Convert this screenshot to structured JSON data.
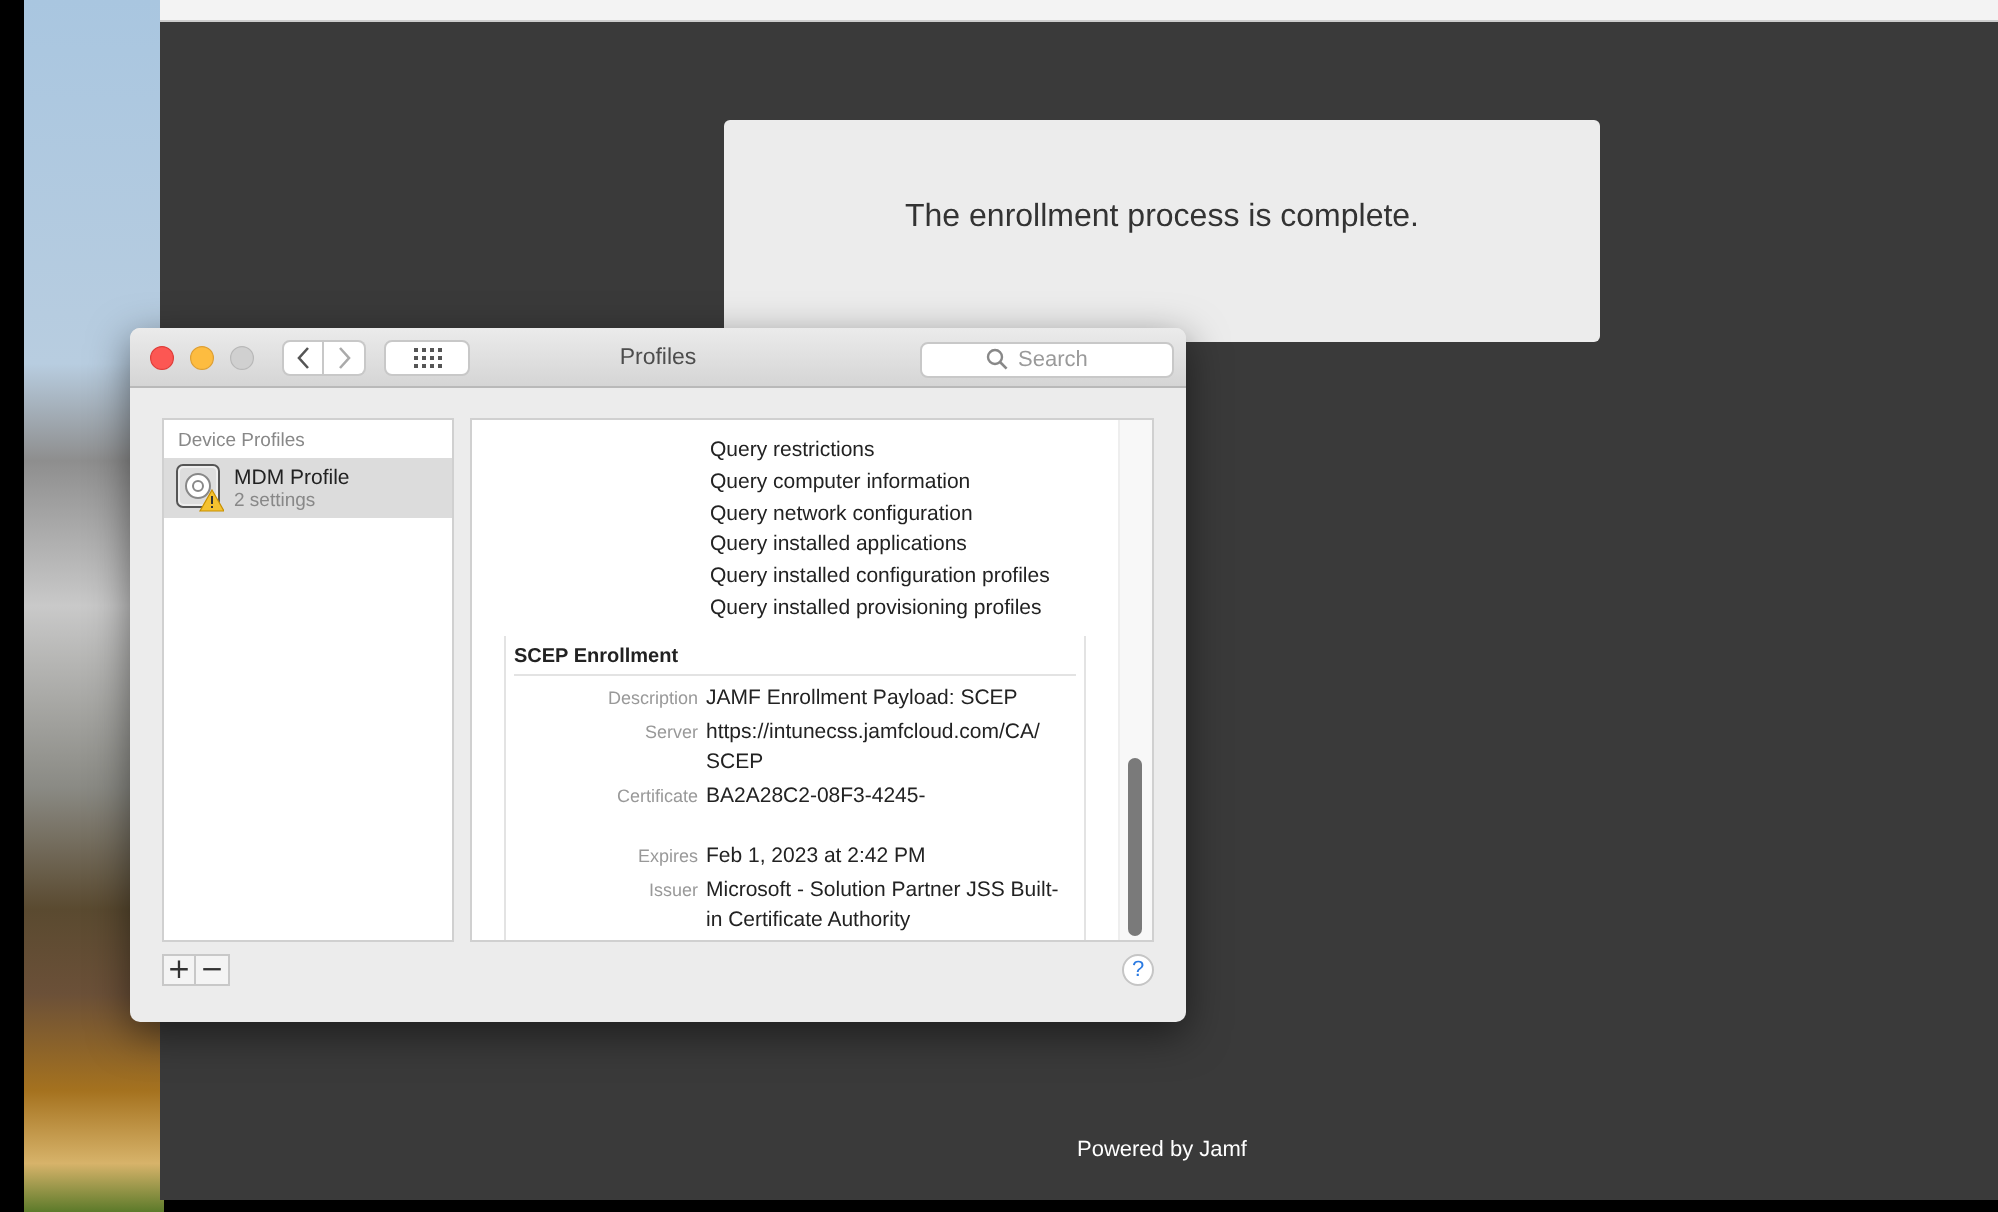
{
  "browser": {
    "message": "The enrollment process is complete.",
    "footer": "Powered by Jamf"
  },
  "window": {
    "title": "Profiles",
    "search": {
      "placeholder": "Search"
    }
  },
  "sidebar": {
    "heading": "Device Profiles",
    "items": [
      {
        "name": "MDM Profile",
        "detail": "2 settings",
        "selected": true
      }
    ]
  },
  "detail": {
    "permissions": [
      "Query restrictions",
      "Query computer information",
      "Query network configuration",
      "Query installed applications",
      "Query installed configuration profiles",
      "Query installed provisioning profiles"
    ],
    "sections": [
      {
        "title": "SCEP Enrollment",
        "fields": [
          {
            "label": "Description",
            "value": "JAMF Enrollment Payload: SCEP"
          },
          {
            "label": "Server",
            "value": "https://intunecss.jamfcloud.com/CA/SCEP"
          },
          {
            "label": "Certificate",
            "value": "BA2A28C2-08F3-4245-"
          },
          {
            "label": "Expires",
            "value": "Feb 1, 2023 at 2:42 PM"
          },
          {
            "label": "Issuer",
            "value": "Microsoft - Solution Partner JSS Built-in Certificate Authority"
          }
        ]
      }
    ]
  },
  "footer_buttons": {
    "add": "+",
    "remove": "−",
    "help": "?"
  }
}
